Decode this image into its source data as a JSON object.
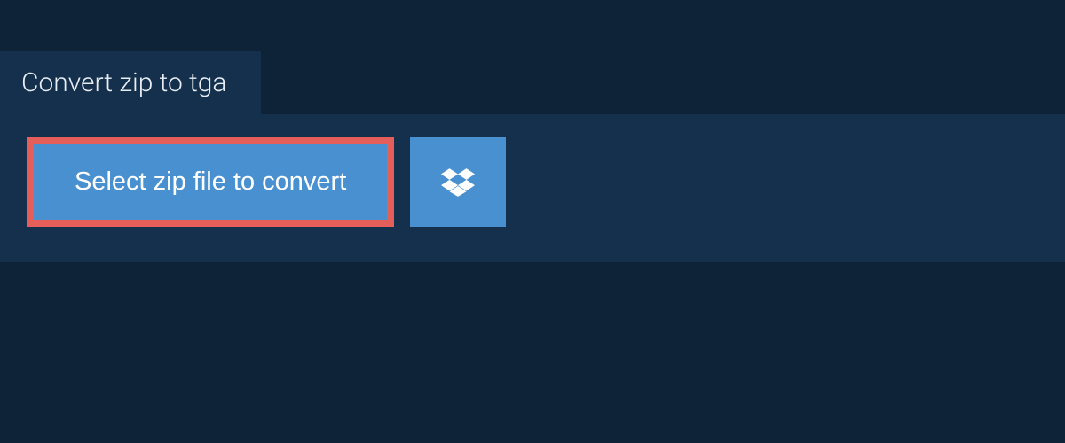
{
  "header": {
    "title": "Convert zip to tga"
  },
  "actions": {
    "select_label": "Select zip file to convert"
  }
}
